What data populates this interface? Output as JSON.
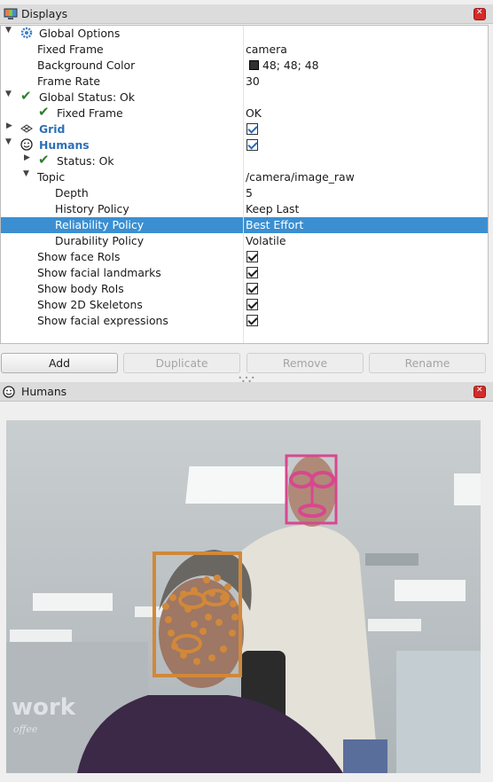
{
  "displays_panel": {
    "title": "Displays"
  },
  "tree": {
    "global_options": "Global Options",
    "fixed_frame": {
      "label": "Fixed Frame",
      "value": "camera"
    },
    "background_color": {
      "label": "Background Color",
      "value": "48; 48; 48"
    },
    "frame_rate": {
      "label": "Frame Rate",
      "value": "30"
    },
    "global_status": "Global Status: Ok",
    "global_status_fixed_frame": {
      "label": "Fixed Frame",
      "value": "OK"
    },
    "grid": "Grid",
    "humans": "Humans",
    "humans_status": "Status: Ok",
    "topic": {
      "label": "Topic",
      "value": "/camera/image_raw"
    },
    "depth": {
      "label": "Depth",
      "value": "5"
    },
    "history_policy": {
      "label": "History Policy",
      "value": "Keep Last"
    },
    "reliability_policy": {
      "label": "Reliability Policy",
      "value": "Best Effort"
    },
    "durability_policy": {
      "label": "Durability Policy",
      "value": "Volatile"
    },
    "show_face_rois": "Show face RoIs",
    "show_facial_landmarks": "Show facial landmarks",
    "show_body_rois": "Show body RoIs",
    "show_2d_skeletons": "Show 2D Skeletons",
    "show_facial_expressions": "Show facial expressions"
  },
  "buttons": {
    "add": "Add",
    "duplicate": "Duplicate",
    "remove": "Remove",
    "rename": "Rename"
  },
  "humans_panel": {
    "title": "Humans"
  },
  "camera_view": {
    "wall_text": "work",
    "wall_text2": "offee"
  },
  "colors": {
    "selection": "#3b8fd1",
    "face_roi_1": "#d8478f",
    "face_roi_2": "#d1883a",
    "checkbox_blue": "#2a6bb0"
  }
}
